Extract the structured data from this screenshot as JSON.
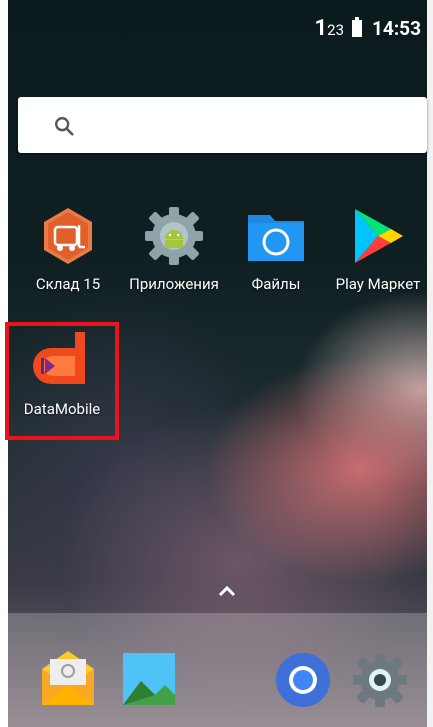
{
  "status": {
    "sim_large": "1",
    "sim_small": "23",
    "time": "14:53"
  },
  "search": {
    "icon": "search-icon"
  },
  "apps": [
    {
      "label": "Склад 15",
      "icon": "forklift-icon"
    },
    {
      "label": "Приложения",
      "icon": "android-gear-icon"
    },
    {
      "label": "Файлы",
      "icon": "folder-icon"
    },
    {
      "label": "Play Маркет",
      "icon": "play-store-icon"
    },
    {
      "label": "DataMobile",
      "icon": "datamobile-icon"
    }
  ],
  "dock": [
    {
      "icon": "email-icon"
    },
    {
      "icon": "gallery-icon"
    },
    {
      "icon": "chrome-icon"
    },
    {
      "icon": "settings-icon"
    }
  ],
  "colors": {
    "highlight": "#e8141c"
  }
}
